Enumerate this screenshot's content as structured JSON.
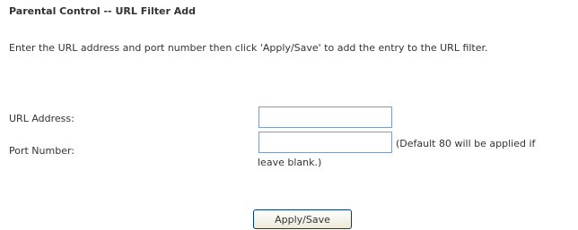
{
  "page": {
    "title": "Parental Control -- URL Filter Add",
    "instructions": "Enter the URL address and port number then click 'Apply/Save' to add the entry to the URL filter."
  },
  "form": {
    "url_label": "URL Address:",
    "url_value": "",
    "port_label": "Port Number:",
    "port_value": "",
    "port_hint_line1": "(Default 80 will be applied if",
    "port_hint_line2": "leave blank.)"
  },
  "actions": {
    "apply_label": "Apply/Save"
  }
}
